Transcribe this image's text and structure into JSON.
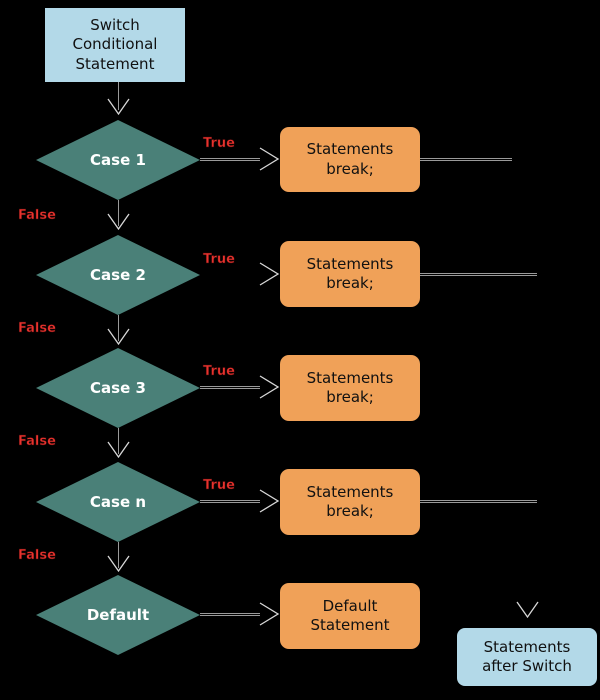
{
  "diagram": {
    "title": "Switch Statement Flowchart",
    "type": "flowchart",
    "background_color": "#000000",
    "palette": {
      "terminal_fill": "#b3d9e8",
      "decision_fill": "#4a8078",
      "process_fill": "#f0a158",
      "connector": "#9a9a9a",
      "label_true_false": "#e8322d",
      "decision_text": "#ffffff",
      "box_text": "#111111"
    }
  },
  "start": {
    "label": "Switch\nConditional\nStatement"
  },
  "end": {
    "label": "Statements\nafter Switch"
  },
  "rows": [
    {
      "decision": "Case 1",
      "true_label": "True",
      "false_label": "False",
      "process": "Statements\nbreak;",
      "has_true_label": true,
      "has_true_line": true,
      "has_exit_line": true
    },
    {
      "decision": "Case 2",
      "true_label": "True",
      "false_label": "False",
      "process": "Statements\nbreak;",
      "has_true_label": true,
      "has_true_line": false,
      "has_exit_line": true
    },
    {
      "decision": "Case 3",
      "true_label": "True",
      "false_label": "False",
      "process": "Statements\nbreak;",
      "has_true_label": true,
      "has_true_line": true,
      "has_exit_line": false
    },
    {
      "decision": "Case n",
      "true_label": "True",
      "false_label": "False",
      "process": "Statements\nbreak;",
      "has_true_label": true,
      "has_true_line": true,
      "has_exit_line": true
    },
    {
      "decision": "Default",
      "true_label": "",
      "false_label": "",
      "process": "Default\nStatement",
      "has_true_label": false,
      "has_true_line": true,
      "has_exit_line": false
    }
  ]
}
